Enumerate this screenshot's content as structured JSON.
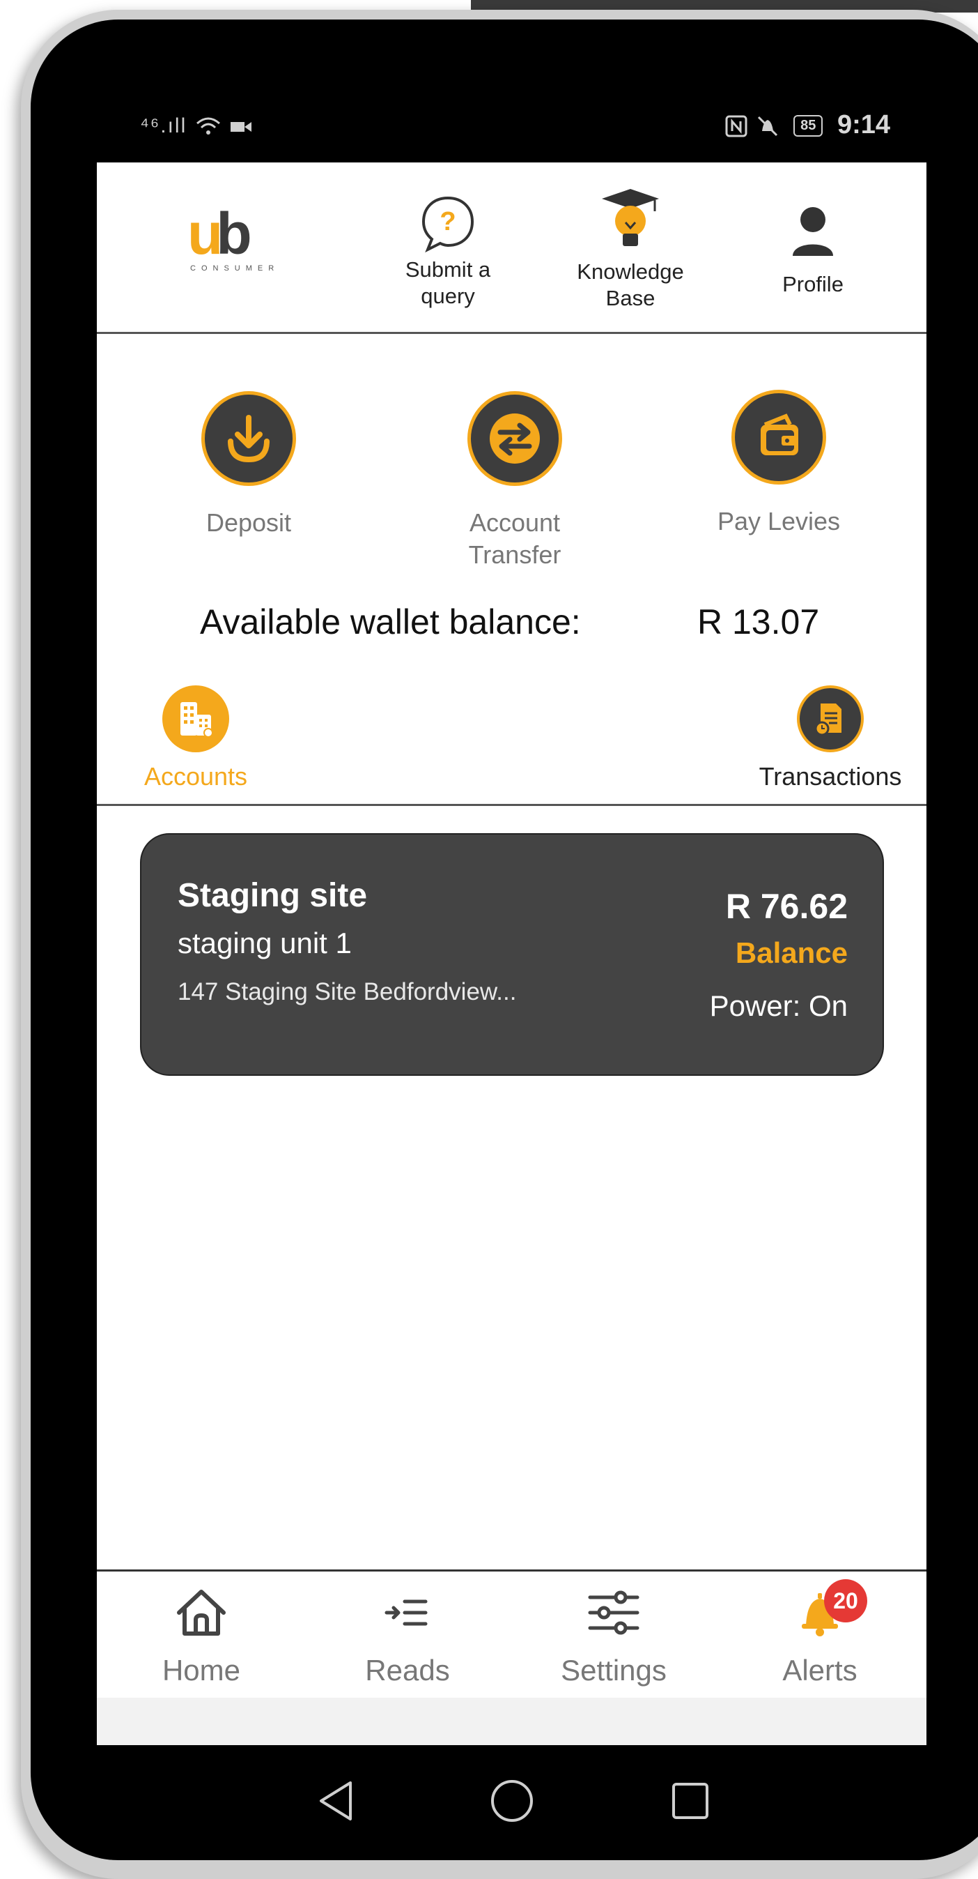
{
  "status_bar": {
    "signal": "⁴⁶.ıll",
    "time": "9:14",
    "battery": "85"
  },
  "header": {
    "logo_text_u": "u",
    "logo_text_b": "b",
    "logo_sub": "CONSUMER",
    "nav": [
      {
        "label": "Submit a\nquery",
        "icon": "question-bubble-icon"
      },
      {
        "label": "Knowledge\nBase",
        "icon": "graduation-bulb-icon"
      },
      {
        "label": "Profile",
        "icon": "person-icon"
      }
    ]
  },
  "actions": [
    {
      "label": "Deposit",
      "icon": "download-icon"
    },
    {
      "label": "Account\nTransfer",
      "icon": "transfer-arrows-icon"
    },
    {
      "label": "Pay Levies",
      "icon": "wallet-icon"
    }
  ],
  "wallet": {
    "label": "Available wallet balance:",
    "value": "R 13.07"
  },
  "tabs": {
    "accounts": {
      "label": "Accounts",
      "icon": "buildings-icon"
    },
    "transactions": {
      "label": "Transactions",
      "icon": "document-clock-icon"
    }
  },
  "account_card": {
    "site": "Staging site",
    "unit": "staging unit 1",
    "address": "147 Staging Site Bedfordview...",
    "amount": "R 76.62",
    "balance_label": "Balance",
    "power": "Power: On"
  },
  "bottom_nav": [
    {
      "label": "Home",
      "icon": "home-icon"
    },
    {
      "label": "Reads",
      "icon": "reads-list-icon"
    },
    {
      "label": "Settings",
      "icon": "sliders-icon"
    },
    {
      "label": "Alerts",
      "icon": "bell-icon",
      "badge": "20"
    }
  ],
  "colors": {
    "accent": "#f4a81c",
    "dark": "#3d3d3d",
    "badge": "#e53935"
  }
}
